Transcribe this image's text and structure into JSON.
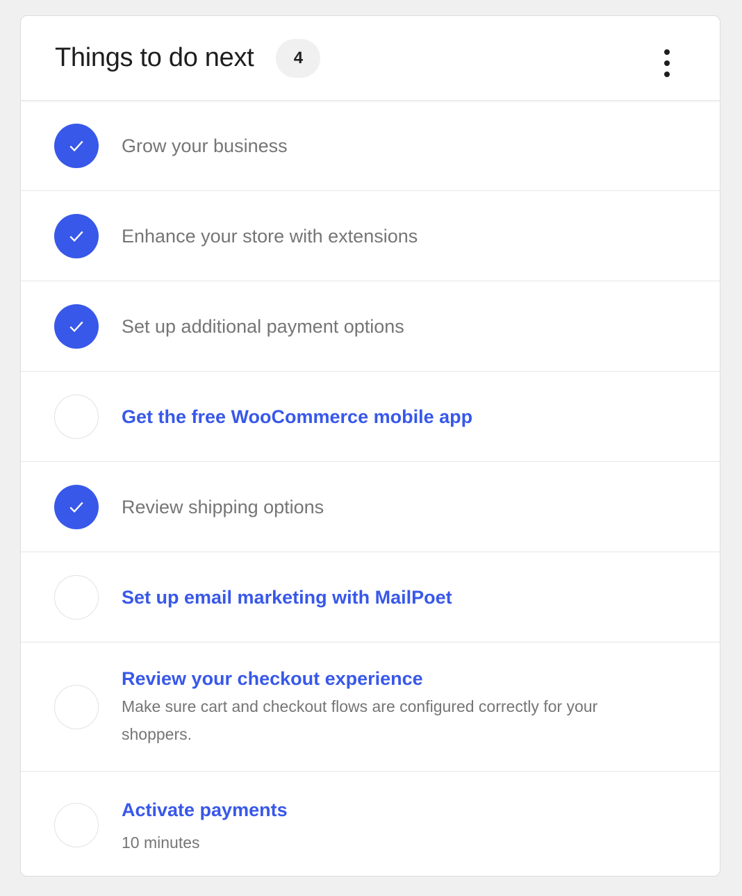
{
  "header": {
    "title": "Things to do next",
    "count": "4"
  },
  "tasks": [
    {
      "title": "Grow your business",
      "completed": true
    },
    {
      "title": "Enhance your store with extensions",
      "completed": true
    },
    {
      "title": "Set up additional payment options",
      "completed": true
    },
    {
      "title": "Get the free WooCommerce mobile app",
      "completed": false
    },
    {
      "title": "Review shipping options",
      "completed": true
    },
    {
      "title": "Set up email marketing with MailPoet",
      "completed": false
    },
    {
      "title": "Review your checkout experience",
      "description": "Make sure cart and checkout flows are configured correctly for your shoppers.",
      "completed": false
    },
    {
      "title": "Activate payments",
      "time": "10 minutes",
      "completed": false
    }
  ],
  "icons": {
    "check": "check-icon",
    "more": "more-vertical-icon"
  },
  "colors": {
    "accent": "#3858e9",
    "muted_text": "#757575",
    "title_text": "#1e1e1e"
  }
}
